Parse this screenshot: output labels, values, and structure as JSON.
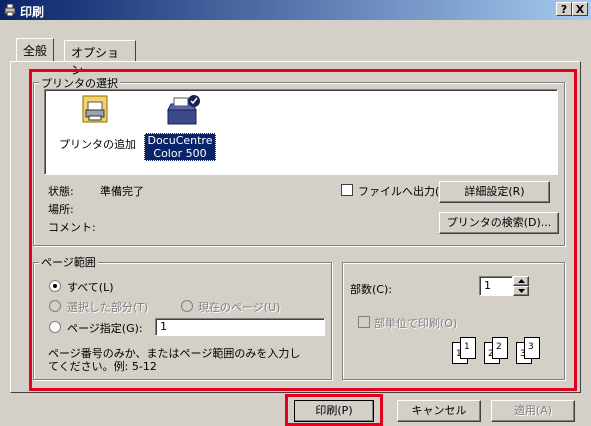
{
  "window": {
    "title": "印刷",
    "help_btn": "?",
    "close_btn": "X"
  },
  "tabs": [
    {
      "label": "全般"
    },
    {
      "label": "オプション"
    }
  ],
  "printer_select": {
    "legend": "プリンタの選択",
    "items": [
      {
        "label": "プリンタの追加",
        "icon": "add-printer-icon"
      },
      {
        "label_line1": "DocuCentre",
        "label_line2": "Color 500",
        "icon": "printer-icon",
        "selected": true
      }
    ]
  },
  "status": {
    "state_label": "状態:",
    "state_value": "準備完了",
    "location_label": "場所:",
    "comment_label": "コメント:"
  },
  "print_to_file": "ファイルへ出力(F)",
  "details_button": "詳細設定(R)",
  "find_printer_button": "プリンタの検索(D)...",
  "page_range": {
    "legend": "ページ範囲",
    "all": "すべて(L)",
    "selection": "選択した部分(T)",
    "current_page": "現在のページ(U)",
    "pages": "ページ指定(G):",
    "pages_value": "1",
    "help_line1": "ページ番号のみか、またはページ範囲のみを入力し",
    "help_line2": "てください。例: 5-12"
  },
  "copies": {
    "label": "部数(C):",
    "value": "1",
    "collate": "部単位で印刷(O)",
    "collate_pages": [
      "1",
      "1",
      "2",
      "2",
      "3",
      "3"
    ]
  },
  "footer": {
    "print_button": "印刷(P)",
    "cancel_button": "キャンセル",
    "apply_button": "適用(A)"
  },
  "highlight_color": "#e3001b"
}
